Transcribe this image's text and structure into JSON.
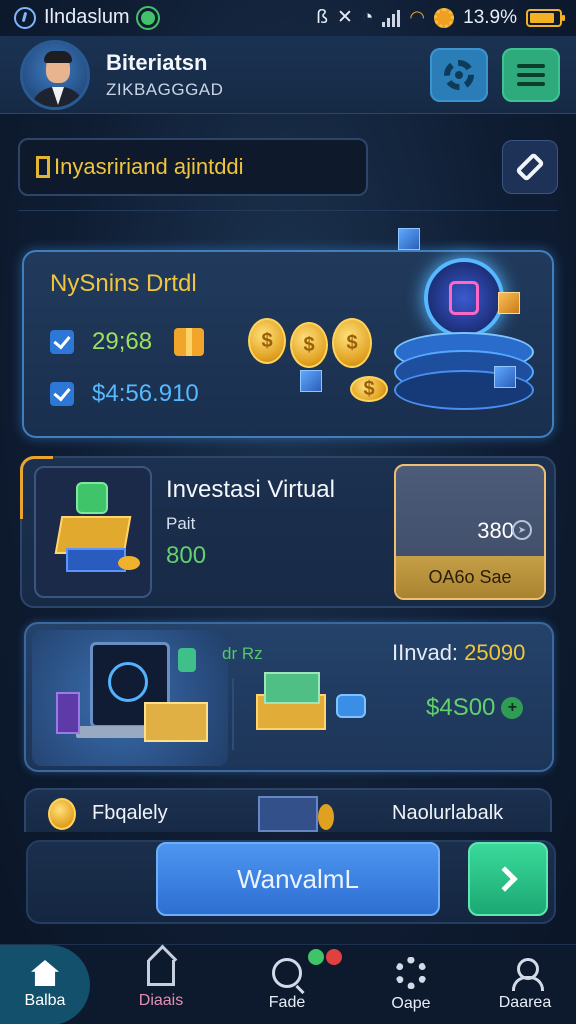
{
  "status_bar": {
    "app_label": "Ilndaslum",
    "battery_percent": "13.9%"
  },
  "header": {
    "user_name": "Biteriatsn",
    "user_subtitle": "ZIKBAGGGAD"
  },
  "search": {
    "text": "Inyasririand ajintddi"
  },
  "card1": {
    "title": "NySnins Drtdl",
    "stat1": "29;68",
    "stat2": "$4:56.910"
  },
  "card2": {
    "title": "Investasi Virtual",
    "subtitle": "Pait",
    "amount": "800",
    "side_value": "380",
    "side_button": "OA6o Sae"
  },
  "card3": {
    "tag": "dr Rz",
    "title_label": "IInvad:",
    "title_value": "25090",
    "amount": "$4S00"
  },
  "card4": {
    "label": "Fbqalely",
    "right_label": "Naolurlabalk"
  },
  "action": {
    "primary_label": "WanvalmL"
  },
  "nav": [
    {
      "label": "Balba"
    },
    {
      "label": "Diaais"
    },
    {
      "label": "Fade"
    },
    {
      "label": "Oape"
    },
    {
      "label": "Daarea"
    }
  ],
  "colors": {
    "accent_gold": "#f0c43c",
    "accent_green": "#61d26a",
    "accent_blue": "#2e6ed2",
    "accent_teal": "#2eaa7c"
  }
}
